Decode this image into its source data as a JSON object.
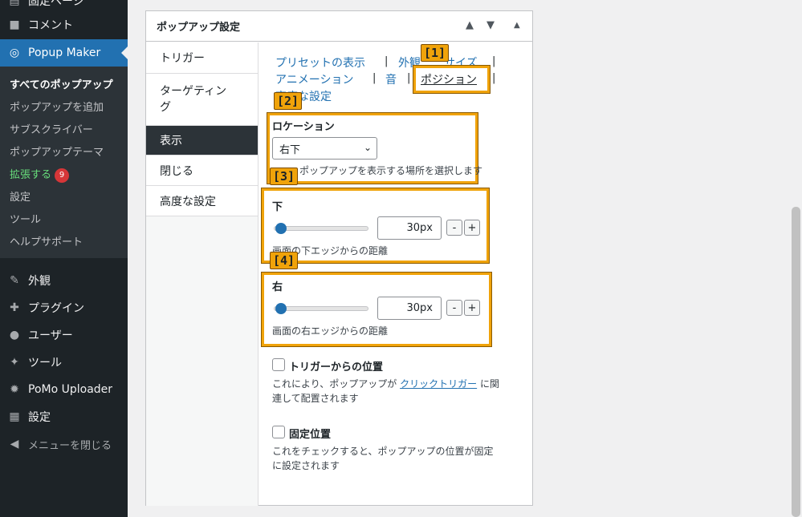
{
  "sidebar": {
    "top_partial": "固定ページ",
    "comments": "コメント",
    "popup_maker": "Popup Maker",
    "submenu": {
      "all_popups": "すべてのポップアップ",
      "add_popup": "ポップアップを追加",
      "subscribers": "サブスクライバー",
      "themes": "ポップアップテーマ",
      "extend": "拡張する",
      "extend_badge": "9",
      "settings": "設定",
      "tools": "ツール",
      "help": "ヘルプサポート"
    },
    "appearance": "外観",
    "plugins": "プラグイン",
    "users": "ユーザー",
    "tools": "ツール",
    "pomo": "PoMo Uploader",
    "settings": "設定",
    "collapse": "メニューを閉じる"
  },
  "panel": {
    "title": "ポップアップ設定",
    "tabs": [
      "トリガー",
      "ターゲティング",
      "表示",
      "閉じる",
      "高度な設定"
    ],
    "tab_targeting_line1": "ターゲティン",
    "tab_targeting_line2": "グ"
  },
  "subnav": {
    "preset": "プリセットの表示",
    "appearance": "外観",
    "size": "サイズ",
    "animation": "アニメーション",
    "sound": "音",
    "position": "ポジション",
    "advanced": "高度な設定",
    "sep": "|"
  },
  "markers": [
    "[1]",
    "[2]",
    "[3]",
    "[4]"
  ],
  "location": {
    "label": "ロケーション",
    "selected": "右下",
    "desc": "ポップアップを表示する場所を選択します"
  },
  "bottom": {
    "label": "下",
    "value": "30px",
    "desc": "画面の下エッジからの距離",
    "minus": "-",
    "plus": "+"
  },
  "right": {
    "label": "右",
    "value": "30px",
    "desc": "画面の右エッジからの距離",
    "minus": "-",
    "plus": "+"
  },
  "trigger_position": {
    "label": "トリガーからの位置",
    "desc_before": "これにより、ポップアップが ",
    "desc_link": "クリックトリガー",
    "desc_after": " に関",
    "desc_line2": "連して配置されます",
    "checked": false
  },
  "fixed_position": {
    "label": "固定位置",
    "desc_line1": "これをチェックすると、ポップアップの位置が固定",
    "desc_line2": "に設定されます",
    "checked": false
  },
  "colors": {
    "highlight": "#f0a30a",
    "wp_blue": "#2271b1",
    "admin_dark": "#1d2327"
  }
}
